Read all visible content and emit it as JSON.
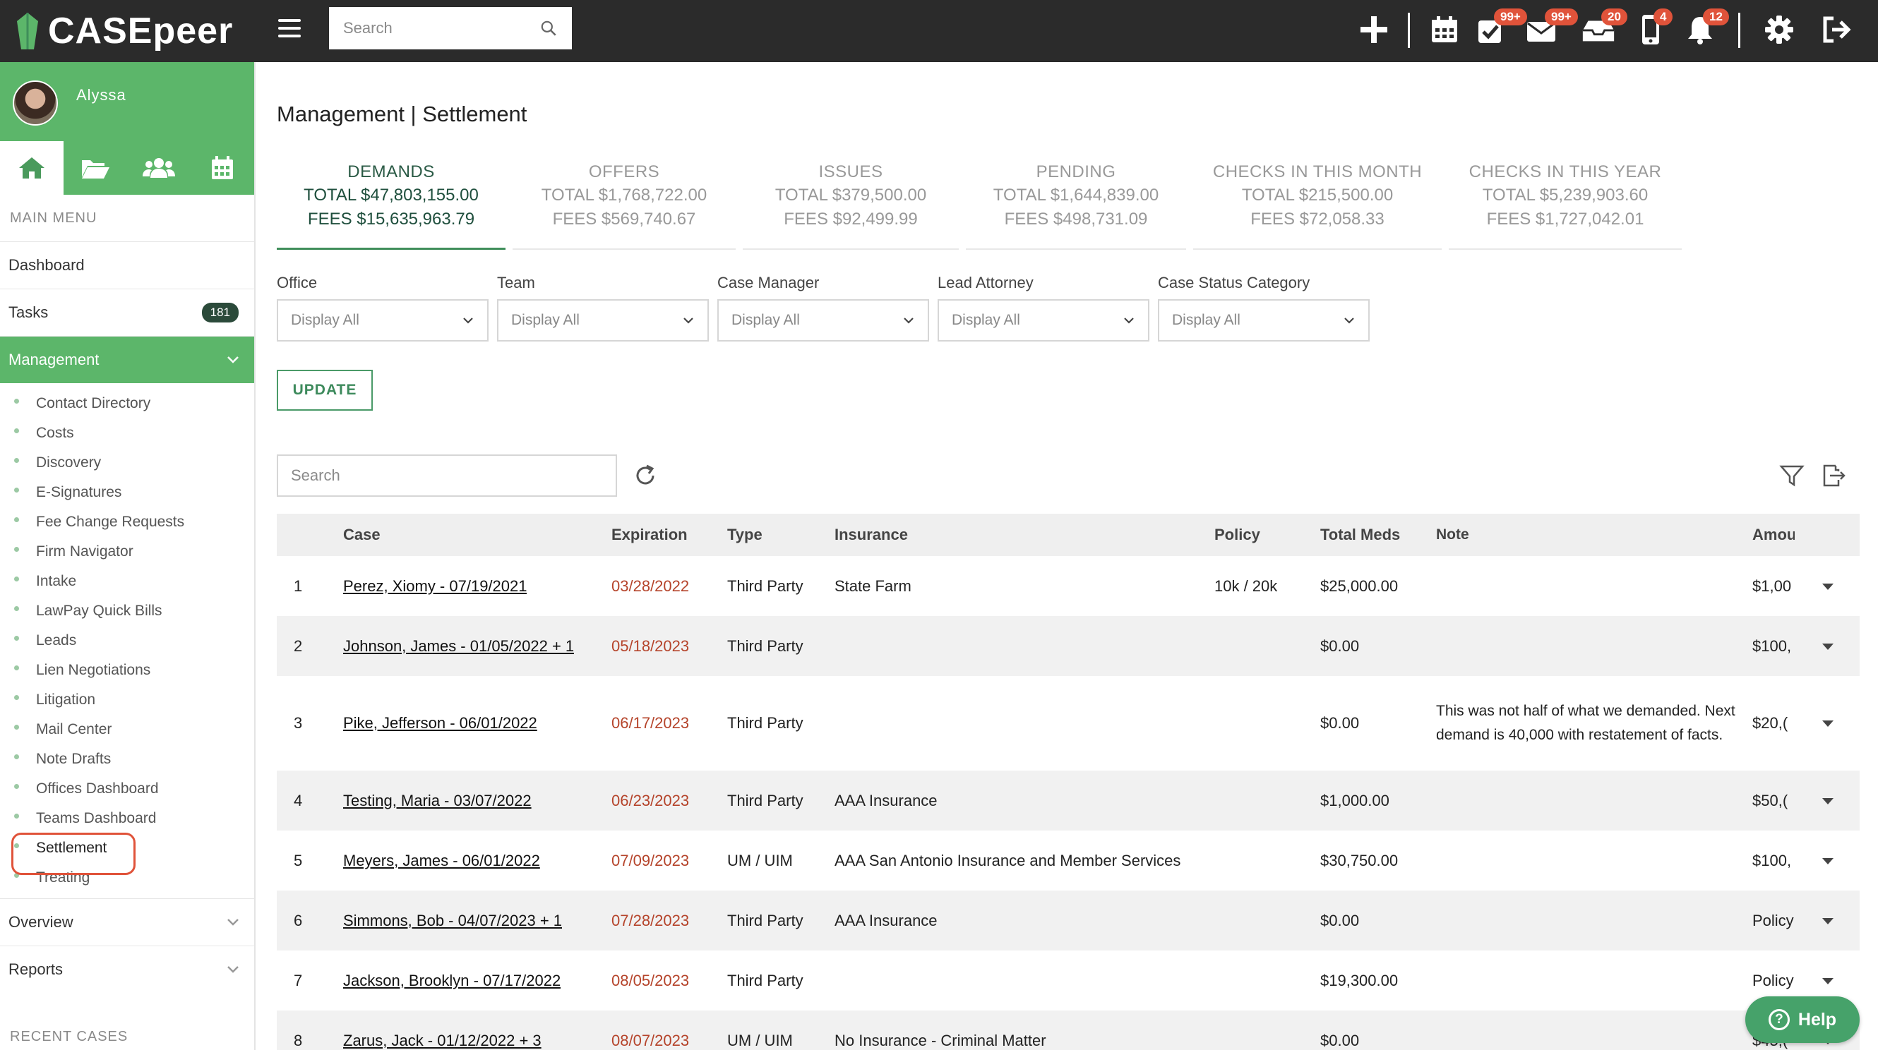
{
  "app": {
    "name": "CASEpeer"
  },
  "topbar": {
    "search_placeholder": "Search",
    "badges": {
      "tasks": "99+",
      "mail": "99+",
      "inbox": "20",
      "phone": "4",
      "notifications": "12"
    },
    "icons": [
      "plus-icon",
      "calendar-icon",
      "tasks-check-icon",
      "mail-icon",
      "inbox-icon",
      "phone-icon",
      "bell-icon",
      "gear-icon",
      "logout-icon"
    ]
  },
  "sidebar": {
    "username": "Alyssa",
    "main_menu_label": "MAIN MENU",
    "items": {
      "dashboard": "Dashboard",
      "tasks": "Tasks",
      "tasks_count": "181",
      "management": "Management",
      "overview": "Overview",
      "reports": "Reports"
    },
    "management_sub": [
      "Contact Directory",
      "Costs",
      "Discovery",
      "E-Signatures",
      "Fee Change Requests",
      "Firm Navigator",
      "Intake",
      "LawPay Quick Bills",
      "Leads",
      "Lien Negotiations",
      "Litigation",
      "Mail Center",
      "Note Drafts",
      "Offices Dashboard",
      "Teams Dashboard",
      "Settlement",
      "Treating"
    ],
    "recent_label": "RECENT CASES"
  },
  "main": {
    "title": "Management | Settlement",
    "tabs": [
      {
        "name": "DEMANDS",
        "total": "TOTAL $47,803,155.00",
        "fees": "FEES $15,635,963.79",
        "active": true
      },
      {
        "name": "OFFERS",
        "total": "TOTAL $1,768,722.00",
        "fees": "FEES $569,740.67"
      },
      {
        "name": "ISSUES",
        "total": "TOTAL $379,500.00",
        "fees": "FEES $92,499.99"
      },
      {
        "name": "PENDING",
        "total": "TOTAL $1,644,839.00",
        "fees": "FEES $498,731.09"
      },
      {
        "name": "CHECKS IN THIS MONTH",
        "total": "TOTAL $215,500.00",
        "fees": "FEES $72,058.33"
      },
      {
        "name": "CHECKS IN THIS YEAR",
        "total": "TOTAL $5,239,903.60",
        "fees": "FEES $1,727,042.01"
      }
    ],
    "filters": [
      {
        "label": "Office",
        "value": "Display All"
      },
      {
        "label": "Team",
        "value": "Display All"
      },
      {
        "label": "Case Manager",
        "value": "Display All"
      },
      {
        "label": "Lead Attorney",
        "value": "Display All"
      },
      {
        "label": "Case Status Category",
        "value": "Display All"
      }
    ],
    "update_label": "UPDATE",
    "table_search_placeholder": "Search",
    "table": {
      "headers": {
        "case": "Case",
        "expiration": "Expiration",
        "type": "Type",
        "insurance": "Insurance",
        "policy": "Policy",
        "total_meds": "Total Meds",
        "note": "Note",
        "amount": "Amou"
      },
      "rows": [
        {
          "num": "1",
          "case": "Perez, Xiomy - 07/19/2021",
          "expiration": "03/28/2022",
          "type": "Third Party",
          "insurance": "State Farm",
          "policy": "10k / 20k",
          "meds": "$25,000.00",
          "note": "",
          "amount": "$1,00"
        },
        {
          "num": "2",
          "case": "Johnson, James - 01/05/2022 + 1",
          "expiration": "05/18/2023",
          "type": "Third Party",
          "insurance": "",
          "policy": "",
          "meds": "$0.00",
          "note": "",
          "amount": "$100,"
        },
        {
          "num": "3",
          "case": "Pike, Jefferson - 06/01/2022",
          "expiration": "06/17/2023",
          "type": "Third Party",
          "insurance": "",
          "policy": "",
          "meds": "$0.00",
          "note": "This was not half of what we demanded. Next demand is 40,000 with restatement of facts.",
          "amount": "$20,("
        },
        {
          "num": "4",
          "case": "Testing, Maria - 03/07/2022",
          "expiration": "06/23/2023",
          "type": "Third Party",
          "insurance": "AAA Insurance",
          "policy": "",
          "meds": "$1,000.00",
          "note": "",
          "amount": "$50,("
        },
        {
          "num": "5",
          "case": "Meyers, James - 06/01/2022",
          "expiration": "07/09/2023",
          "type": "UM / UIM",
          "insurance": "AAA San Antonio Insurance and Member Services",
          "policy": "",
          "meds": "$30,750.00",
          "note": "",
          "amount": "$100,"
        },
        {
          "num": "6",
          "case": "Simmons, Bob - 04/07/2023 + 1",
          "expiration": "07/28/2023",
          "type": "Third Party",
          "insurance": "AAA Insurance",
          "policy": "",
          "meds": "$0.00",
          "note": "",
          "amount": "Policy"
        },
        {
          "num": "7",
          "case": "Jackson, Brooklyn - 07/17/2022",
          "expiration": "08/05/2023",
          "type": "Third Party",
          "insurance": "",
          "policy": "",
          "meds": "$19,300.00",
          "note": "",
          "amount": "Policy"
        },
        {
          "num": "8",
          "case": "Zarus, Jack - 01/12/2022 + 3",
          "expiration": "08/07/2023",
          "type": "UM / UIM",
          "insurance": "No Insurance - Criminal Matter",
          "policy": "",
          "meds": "$0.00",
          "note": "",
          "amount": "$45,("
        }
      ]
    }
  },
  "help": {
    "label": "Help"
  },
  "colors": {
    "topbar": "#2b2b2b",
    "brand_green": "#5cb66a",
    "badge_red": "#e0533a",
    "expiration_red": "#b5442b",
    "active_tab_text": "#2a5a45"
  }
}
